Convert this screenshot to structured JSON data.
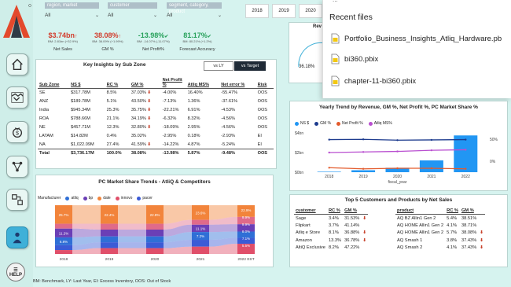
{
  "colors": {
    "accent": "#3fb0d8",
    "negative": "#d23c2c",
    "positive": "#27a15b",
    "logo_red": "#e3492c",
    "logo_dark": "#2f3b46"
  },
  "filters": [
    {
      "label": "region, market",
      "value": "All"
    },
    {
      "label": "customer",
      "value": "All"
    },
    {
      "label": "segment, category, product",
      "value": "All"
    }
  ],
  "years": [
    "2018",
    "2019",
    "2020"
  ],
  "kpis": [
    {
      "value": "$3.74bn",
      "arrow": "↑",
      "sub": "BM: 2.81bn (+32.9%)",
      "label": "Net Sales",
      "tone": "negative"
    },
    {
      "value": "38.08%",
      "arrow": "↑",
      "sub": "BM: 36.09% (+1.99%)",
      "label": "GM %",
      "tone": "negative"
    },
    {
      "value": "-13.98%",
      "arrow": "✔",
      "sub": "BM: -14.07% (-11.07%)",
      "label": "Net Profit%",
      "tone": "positive"
    },
    {
      "value": "81.17%",
      "arrow": "✔",
      "sub": "BM: 80.21% (+1.2%)",
      "label": "Forecast Accuracy",
      "tone": "positive"
    }
  ],
  "insights": {
    "title": "Key Insights by Sub Zone",
    "toggle_ly": "vs LY",
    "toggle_target": "vs Target",
    "headers": [
      "Sub Zone",
      "NS $",
      "RC %",
      "GM %",
      "Net Profit %",
      "Atliq MS%",
      "Net error %",
      "Risk"
    ],
    "rows": [
      [
        "SE",
        "$317.78M",
        "8.5%",
        "37.03%",
        "-4.00%",
        "16.40%",
        "-55.47%",
        "OOS"
      ],
      [
        "ANZ",
        "$189.78M",
        "5.1%",
        "43.50%",
        "-7.13%",
        "1.36%",
        "-37.61%",
        "OOS"
      ],
      [
        "India",
        "$945.34M",
        "25.3%",
        "35.75%",
        "-22.21%",
        "6.91%",
        "-4.53%",
        "OOS"
      ],
      [
        "ROA",
        "$788.66M",
        "21.1%",
        "34.19%",
        "-6.32%",
        "8.32%",
        "-4.56%",
        "OOS"
      ],
      [
        "NE",
        "$457.71M",
        "12.3%",
        "32.80%",
        "-18.09%",
        "2.95%",
        "-4.56%",
        "OOS"
      ],
      [
        "LATAM",
        "$14.82M",
        "0.4%",
        "35.02%",
        "-2.95%",
        "0.18%",
        "-2.93%",
        "EI"
      ],
      [
        "NA",
        "$1,022.09M",
        "27.4%",
        "41.59%",
        "-14.22%",
        "4.87%",
        "-5.24%",
        "EI"
      ]
    ],
    "gm_down": [
      true,
      true,
      true,
      true,
      true,
      false,
      true
    ],
    "total": [
      "Total",
      "$3,736.17M",
      "100.0%",
      "38.08%",
      "-13.98%",
      "5.87%",
      "-9.48%",
      "OOS"
    ]
  },
  "recent": {
    "partial_top": "...",
    "title": "Recent files",
    "files": [
      "Portfolio_Business_Insights_Atliq_Hardware.pb",
      "bi360.pbix",
      "chapter-11-bi360.pbix"
    ]
  },
  "behind_popup": {
    "title_frag": "Rev",
    "value_frag": "36.18%"
  },
  "pc_share": {
    "title": "PC Market Share Trends - AtliQ & Competitors",
    "legend_title": "Manufacturer",
    "series_names": [
      "atliq",
      "bp",
      "dale",
      "innovo",
      "pacer"
    ],
    "series_colors": [
      "#2f6fd6",
      "#6b3fb6",
      "#f2843b",
      "#e04f6a",
      "#3b5bd6"
    ],
    "years": [
      "2018",
      "2019",
      "2020",
      "2021",
      "2022 EST"
    ],
    "labels_top": [
      "25.7%",
      "22.4%",
      "22.8%",
      "23.6%",
      "22.9%"
    ],
    "labels_a": [
      "11.2%",
      "",
      "",
      "11.1%",
      "9.9%"
    ],
    "labels_b": [
      "6.8%",
      "",
      "",
      "7.2%",
      "9.9%"
    ],
    "labels_c": [
      "",
      "",
      "",
      "",
      "8.0%"
    ],
    "labels_d": [
      "",
      "",
      "",
      "",
      "7.1%"
    ],
    "labels_e": [
      "",
      "",
      "",
      "",
      "5.5%"
    ]
  },
  "chart_data": {
    "type": "bar",
    "title": "Yearly Trend by Revenue, GM %, Net Profit %, PC Market Share %",
    "xlabel": "fiscal_year",
    "categories": [
      "2018",
      "2019",
      "2020",
      "2021",
      "2022"
    ],
    "series": [
      {
        "name": "NS $",
        "values": [
          0.05,
          0.2,
          0.45,
          1.2,
          3.74
        ]
      },
      {
        "name": "GM %",
        "values": [
          38,
          38.5,
          37,
          37.5,
          38
        ]
      },
      {
        "name": "Net Profit %",
        "values": [
          -12,
          -14,
          -13,
          -13,
          -14
        ]
      },
      {
        "name": "Atliq MS%",
        "values": [
          15,
          16,
          17,
          19,
          20
        ]
      }
    ],
    "y_left_ticks": [
      "$4bn",
      "$2bn",
      "$0bn"
    ],
    "y_right_ticks": [
      "50%",
      "0%"
    ],
    "legend": "top-left"
  },
  "top5": {
    "title": "Top 5 Customers and Products by Net Sales",
    "cust_headers": [
      "customer",
      "RC %",
      "GM %"
    ],
    "customers": [
      [
        "Sage",
        "3.4%",
        "31.53%"
      ],
      [
        "Flipkart",
        "3.7%",
        "41.14%"
      ],
      [
        "Atliq e Store",
        "8.1%",
        "36.88%"
      ],
      [
        "Amazon",
        "13.3%",
        "36.78%"
      ],
      [
        "AltiQ Exclusive",
        "8.2%",
        "47.22%"
      ]
    ],
    "cust_down": [
      true,
      false,
      true,
      true,
      false
    ],
    "prod_headers": [
      "product",
      "RC %",
      "GM %"
    ],
    "products": [
      [
        "AQ BZ Allin1 Gen 2",
        "5.4%",
        "38.51%"
      ],
      [
        "AQ HOME Allin1 Gen 2",
        "4.1%",
        "38.71%"
      ],
      [
        "AQ HOME Allin1 Gen 2",
        "5.7%",
        "38.08%"
      ],
      [
        "AQ Smash 1",
        "3.8%",
        "37.43%"
      ],
      [
        "AQ Smash 2",
        "4.1%",
        "37.43%"
      ]
    ],
    "prod_down": [
      false,
      false,
      true,
      true,
      true
    ]
  },
  "footer": "BM: Benchmark, LY: Last Year, EI: Excess Inventory, OOS: Out of Stock",
  "help_label": "HELP"
}
